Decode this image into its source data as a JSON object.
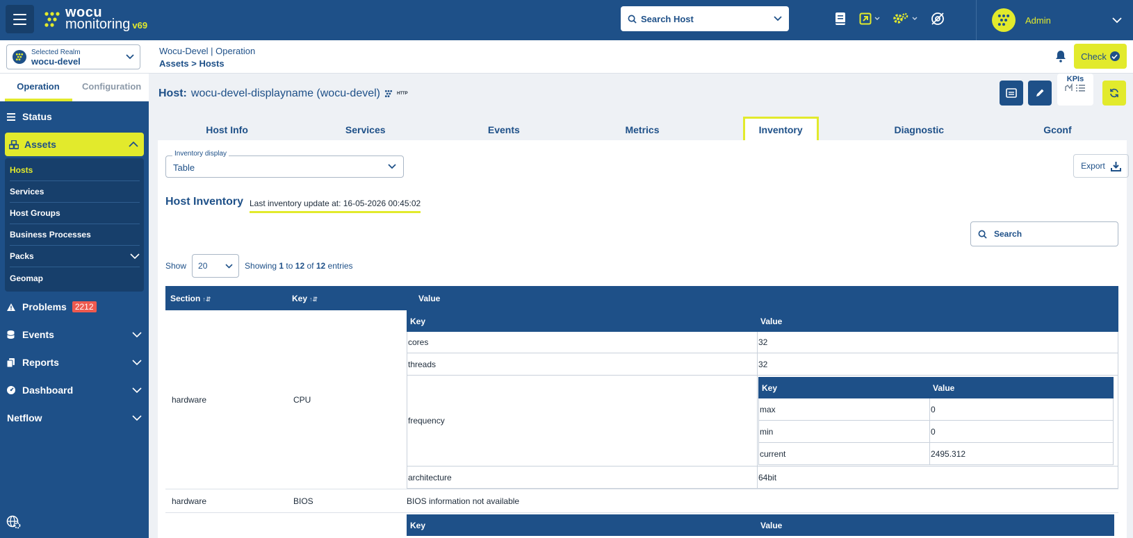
{
  "app": {
    "logo_line1": "wocu",
    "logo_line2": "monitoring",
    "version": "v69",
    "search_host_placeholder": "Search Host",
    "user": "Admin",
    "accent": "#e2ea2c",
    "brand": "#1e5088",
    "danger": "#ee5a4f"
  },
  "realm": {
    "caption": "Selected Realm",
    "value": "wocu-devel"
  },
  "breadcrumb": {
    "line1": "Wocu-Devel | Operation",
    "line2_prefix": "Assets > ",
    "line2_current": "Hosts"
  },
  "header": {
    "check_label": "Check",
    "kpis_label": "KPIs"
  },
  "sidebar": {
    "tabs": [
      "Operation",
      "Configuration"
    ],
    "items": {
      "status": "Status",
      "assets": "Assets",
      "problems": "Problems",
      "problems_count": "2212",
      "events": "Events",
      "reports": "Reports",
      "dashboard": "Dashboard",
      "netflow": "Netflow"
    },
    "assets_sub": [
      "Hosts",
      "Services",
      "Host Groups",
      "Business Processes",
      "Packs",
      "Geomap"
    ]
  },
  "host": {
    "label": "Host:",
    "name": "wocu-devel-displayname (wocu-devel)",
    "tag": "HTTP"
  },
  "tabs": [
    "Host Info",
    "Services",
    "Events",
    "Metrics",
    "Inventory",
    "Diagnostic",
    "Gconf"
  ],
  "inventory": {
    "display_caption": "Inventory display",
    "display_value": "Table",
    "export_label": "Export",
    "title": "Host Inventory",
    "last_update": "Last inventory update at: 16-05-2026 00:45:02",
    "search_placeholder": "Search",
    "show_label": "Show",
    "page_size": "20",
    "showing_prefix": "Showing ",
    "showing_from": "1",
    "showing_to_word": " to ",
    "showing_to": "12",
    "showing_of_word": " of ",
    "showing_total": "12",
    "showing_suffix": " entries"
  },
  "table": {
    "headers": {
      "section": "Section",
      "key": "Key",
      "value": "Value"
    },
    "sub_headers": {
      "key": "Key",
      "value": "Value"
    },
    "rows": {
      "cpu": {
        "section": "hardware",
        "key": "CPU",
        "cores_k": "cores",
        "cores_v": "32",
        "threads_k": "threads",
        "threads_v": "32",
        "frequency_k": "frequency",
        "max_k": "max",
        "max_v": "0",
        "min_k": "min",
        "min_v": "0",
        "current_k": "current",
        "current_v": "2495.312",
        "arch_k": "architecture",
        "arch_v": "64bit"
      },
      "bios": {
        "section": "hardware",
        "key": "BIOS",
        "value": "BIOS information not available"
      }
    }
  }
}
